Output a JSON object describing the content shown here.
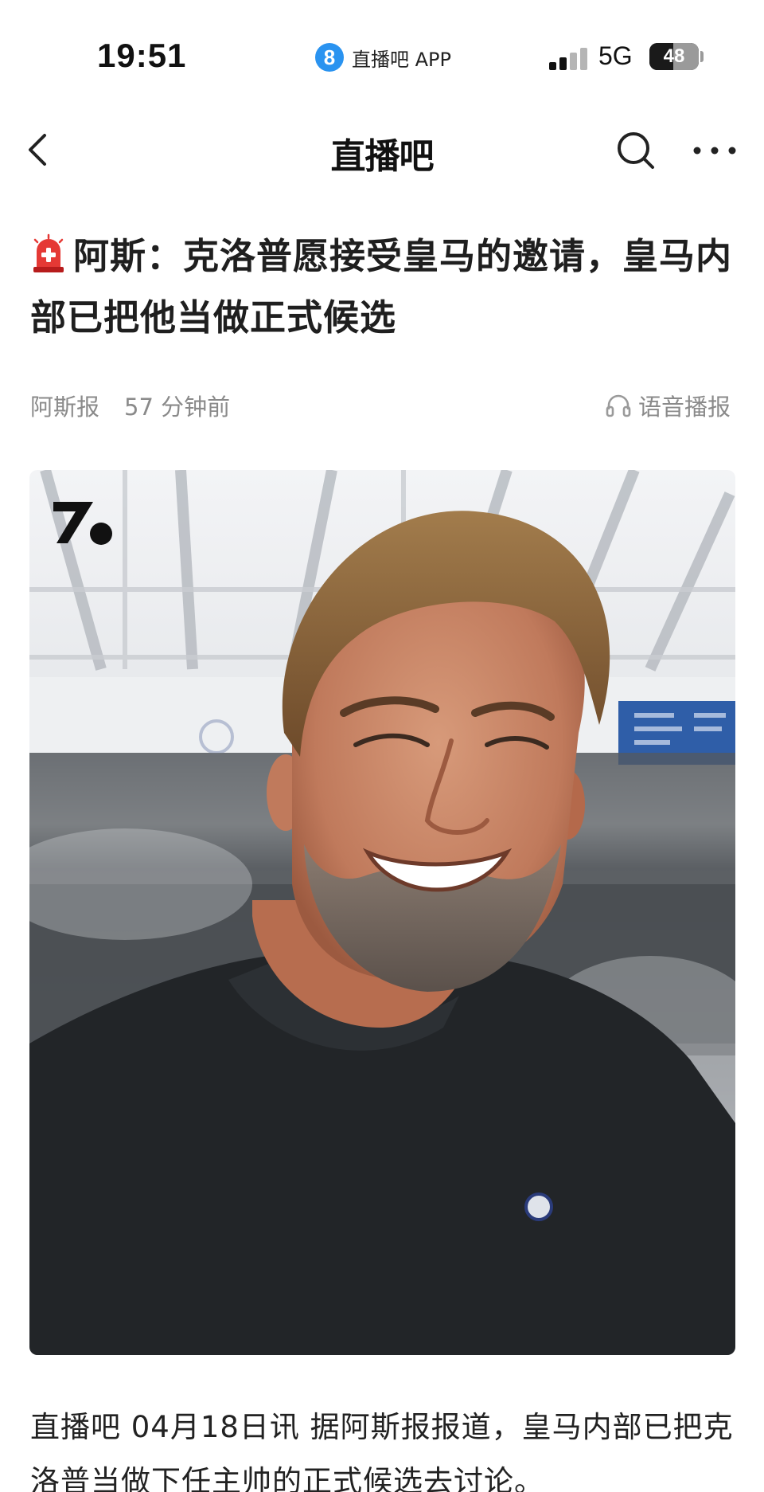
{
  "status_bar": {
    "time": "19:51",
    "app_badge": "8",
    "app_name": "直播吧 APP",
    "network": "5G",
    "battery": "48",
    "battery_level_percent": 48
  },
  "nav": {
    "title": "直播吧"
  },
  "article": {
    "headline": "阿斯：克洛普愿接受皇马的邀请，皇马内部已把他当做正式候选",
    "source": "阿斯报",
    "time_ago": "57 分钟前",
    "audio_label": "语音播报",
    "body": "直播吧 04月18日讯 据阿斯报报道，皇马内部已把克洛普当做下任主帅的正式候选去讨论。"
  },
  "colors": {
    "accent_blue": "#2a93f0",
    "meta_gray": "#8a8a8a",
    "siren_red": "#e53935"
  }
}
